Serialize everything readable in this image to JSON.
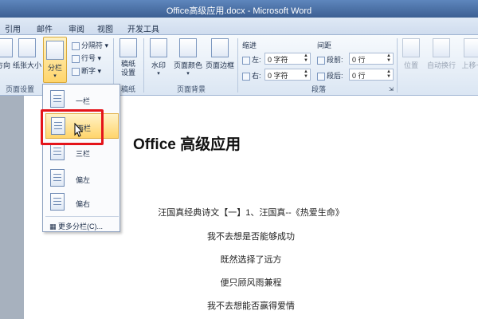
{
  "window": {
    "title": "Office高级应用.docx - Microsoft Word"
  },
  "tabs": [
    {
      "label": "引用"
    },
    {
      "label": "邮件"
    },
    {
      "label": "审阅"
    },
    {
      "label": "视图"
    },
    {
      "label": "开发工具"
    }
  ],
  "ribbon": {
    "page_setup": {
      "direction_label": "方向",
      "size_label": "纸张大小",
      "columns_label": "分栏",
      "separator_label": "分隔符",
      "line_numbers_label": "行号",
      "hyphenation_label": "断字",
      "group_label": "页面设置"
    },
    "draft": {
      "label": "稿纸设置",
      "group_label": "稿纸"
    },
    "background": {
      "watermark_label": "水印",
      "page_color_label": "页面颜色",
      "page_border_label": "页面边框",
      "group_label": "页面背景"
    },
    "paragraph": {
      "indent_title": "缩进",
      "left_label": "左:",
      "left_value": "0 字符",
      "right_label": "右:",
      "right_value": "0 字符",
      "spacing_title": "间距",
      "before_label": "段前:",
      "before_value": "0 行",
      "after_label": "段后:",
      "after_value": "0 行",
      "group_label": "段落"
    },
    "arrange": {
      "position_label": "位置",
      "wrap_label": "自动换行",
      "bring_forward_label": "上移一"
    }
  },
  "columns_menu": {
    "items": [
      {
        "label": "一栏"
      },
      {
        "label": "两栏"
      },
      {
        "label": "三栏"
      },
      {
        "label": "偏左"
      },
      {
        "label": "偏右"
      }
    ],
    "more_label": "更多分栏(C)..."
  },
  "document": {
    "title": "Office 高级应用",
    "lines": [
      "汪国真经典诗文【一】1、汪国真--《热爱生命》",
      "我不去想是否能够成功",
      "既然选择了远方",
      "便只顾风雨兼程",
      "我不去想能否赢得爱情"
    ]
  }
}
